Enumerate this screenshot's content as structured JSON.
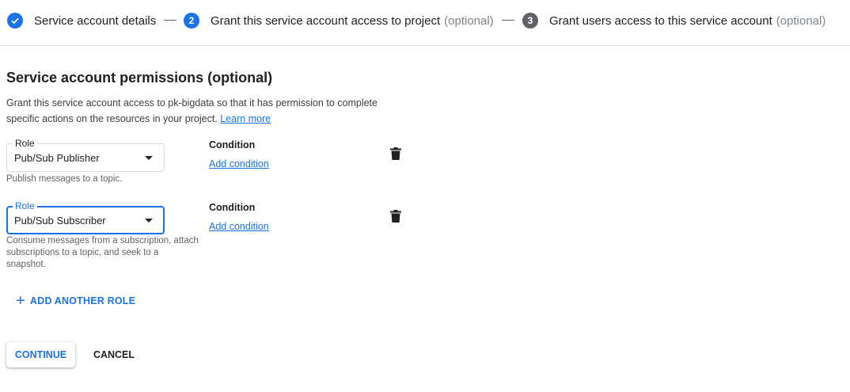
{
  "stepper": {
    "step1": {
      "label": "Service account details",
      "state": "done"
    },
    "step2": {
      "number": "2",
      "label": "Grant this service account access to project",
      "optional": "(optional)",
      "state": "active"
    },
    "step3": {
      "number": "3",
      "label": "Grant users access to this service account",
      "optional": "(optional)",
      "state": "future"
    }
  },
  "section": {
    "title": "Service account permissions (optional)",
    "description": "Grant this service account access to pk-bigdata so that it has permission to complete specific actions on the resources in your project.",
    "learn_more": "Learn more"
  },
  "roles": [
    {
      "field_label": "Role",
      "value": "Pub/Sub Publisher",
      "hint": "Publish messages to a topic.",
      "condition_title": "Condition",
      "condition_link": "Add condition"
    },
    {
      "field_label": "Role",
      "value": "Pub/Sub Subscriber",
      "hint": "Consume messages from a subscription, attach subscriptions to a topic, and seek to a snapshot.",
      "condition_title": "Condition",
      "condition_link": "Add condition"
    }
  ],
  "actions": {
    "add_role": "ADD ANOTHER ROLE",
    "continue": "CONTINUE",
    "cancel": "CANCEL"
  },
  "colors": {
    "accent": "#1a73e8",
    "text": "#202124",
    "muted": "#5f6368",
    "divider": "#dadce0"
  }
}
